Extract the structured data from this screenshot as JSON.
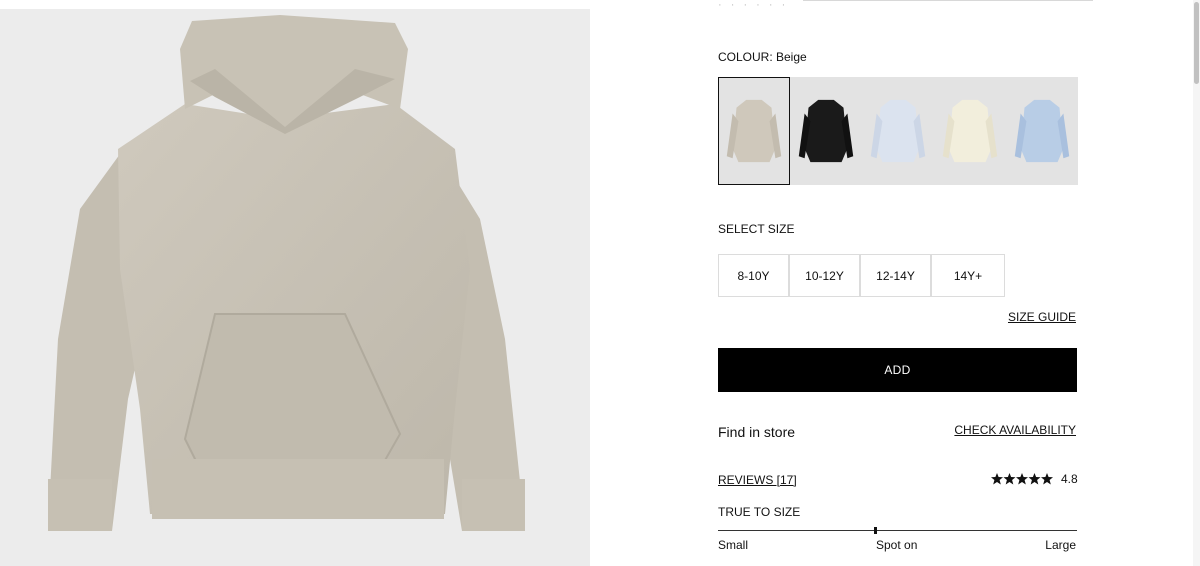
{
  "colour": {
    "label": "COLOUR: Beige",
    "swatches": [
      {
        "name": "Beige",
        "color": "#cfc8bb",
        "selected": true
      },
      {
        "name": "Black",
        "color": "#1a1a1a",
        "selected": false
      },
      {
        "name": "Light blue",
        "color": "#dbe3ef",
        "selected": false
      },
      {
        "name": "Cream",
        "color": "#f2eedc",
        "selected": false
      },
      {
        "name": "Blue",
        "color": "#b8cde6",
        "selected": false
      }
    ]
  },
  "size": {
    "label": "SELECT SIZE",
    "options": [
      "8-10Y",
      "10-12Y",
      "12-14Y",
      "14Y+"
    ],
    "guide_label": "SIZE GUIDE"
  },
  "add_label": "ADD",
  "store": {
    "find_label": "Find in store",
    "check_label": "CHECK AVAILABILITY"
  },
  "reviews": {
    "label": "REVIEWS [17]",
    "rating": "4.8",
    "stars": 5
  },
  "fit": {
    "label": "TRUE TO SIZE",
    "small": "Small",
    "spot_on": "Spot on",
    "large": "Large",
    "position": 0.44
  },
  "colors": {
    "image_bg": "#ececec",
    "hoodie": "#cbc5b8",
    "button_bg": "#000000"
  }
}
